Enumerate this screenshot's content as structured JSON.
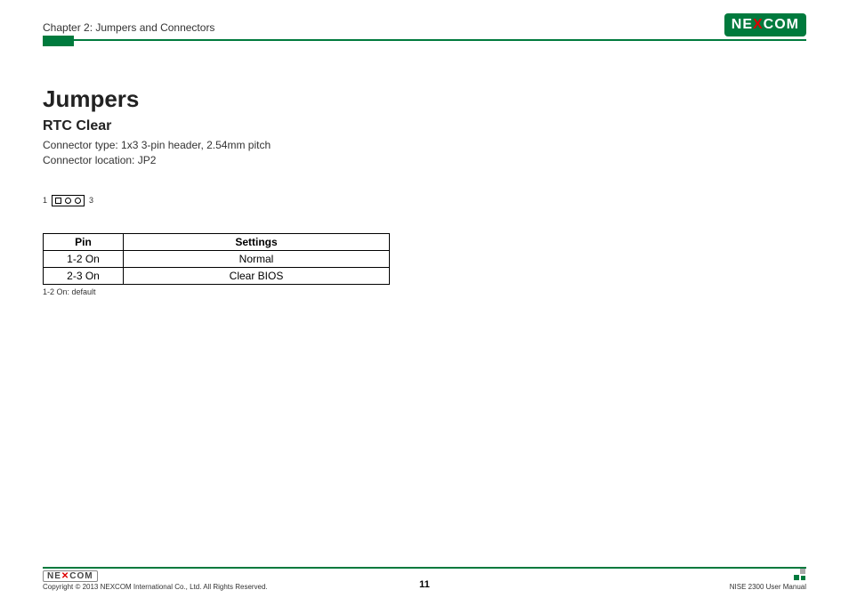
{
  "header": {
    "chapter": "Chapter 2: Jumpers and Connectors",
    "logo_text_ne": "NE",
    "logo_text_x": "X",
    "logo_text_com": "COM"
  },
  "content": {
    "h1": "Jumpers",
    "h2": "RTC Clear",
    "connector_type": "Connector type: 1x3 3-pin header, 2.54mm pitch",
    "connector_location": "Connector location: JP2",
    "diagram": {
      "left_label": "1",
      "right_label": "3"
    },
    "table": {
      "header_pin": "Pin",
      "header_settings": "Settings",
      "rows": [
        {
          "pin": "1-2 On",
          "setting": "Normal"
        },
        {
          "pin": "2-3 On",
          "setting": "Clear BIOS"
        }
      ],
      "note": "1-2 On: default"
    }
  },
  "footer": {
    "logo_text": "NE COM",
    "copyright": "Copyright © 2013 NEXCOM International Co., Ltd. All Rights Reserved.",
    "page_number": "11",
    "manual": "NISE 2300 User Manual"
  }
}
